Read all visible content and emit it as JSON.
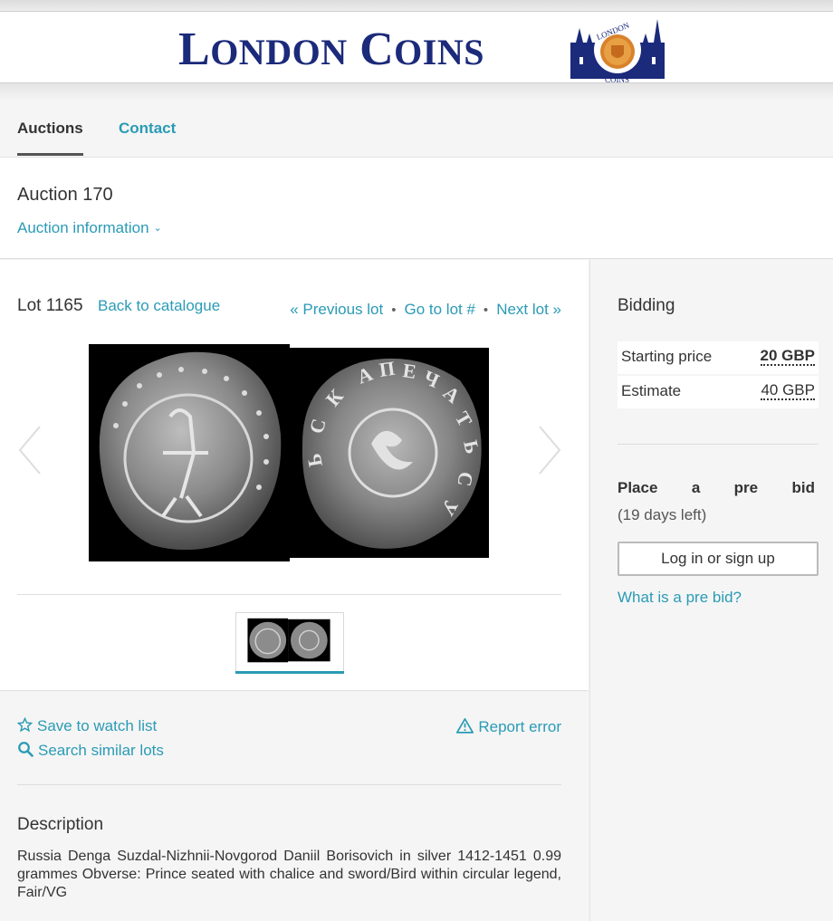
{
  "header": {
    "brand_first": "L",
    "brand_first_rest": "ONDON",
    "brand_second": "C",
    "brand_second_rest": "OINS",
    "logo_text_top": "LONDON",
    "logo_text_bottom": "COINS"
  },
  "nav": {
    "tabs": [
      {
        "label": "Auctions",
        "active": true
      },
      {
        "label": "Contact",
        "active": false
      }
    ]
  },
  "auction": {
    "title": "Auction 170",
    "info_link": "Auction information"
  },
  "lot": {
    "label": "Lot 1165",
    "back_link": "Back to catalogue",
    "previous": "« Previous lot",
    "goto": "Go to lot #",
    "next": "Next lot »",
    "separator": "•"
  },
  "actions": {
    "watch": "Save to watch list",
    "similar": "Search similar lots",
    "report": "Report error"
  },
  "description": {
    "title": "Description",
    "text": "Russia Denga Suzdal-Nizhnii-Novgorod Daniil Borisovich in silver 1412-1451 0.99 grammes Obverse: Prince seated with chalice and sword/Bird within circular legend, Fair/VG"
  },
  "bidding": {
    "title": "Bidding",
    "rows": [
      {
        "label": "Starting price",
        "value": "20 GBP"
      },
      {
        "label": "Estimate",
        "value": "40 GBP"
      }
    ],
    "prebid_words": [
      "Place",
      "a",
      "pre",
      "bid"
    ],
    "days_left": "(19 days left)",
    "login_button": "Log in or sign up",
    "what_is": "What is a pre bid?"
  },
  "colors": {
    "link": "#2a9bb5",
    "brand": "#1b2a7a",
    "logo_gold": "#d9822b"
  }
}
